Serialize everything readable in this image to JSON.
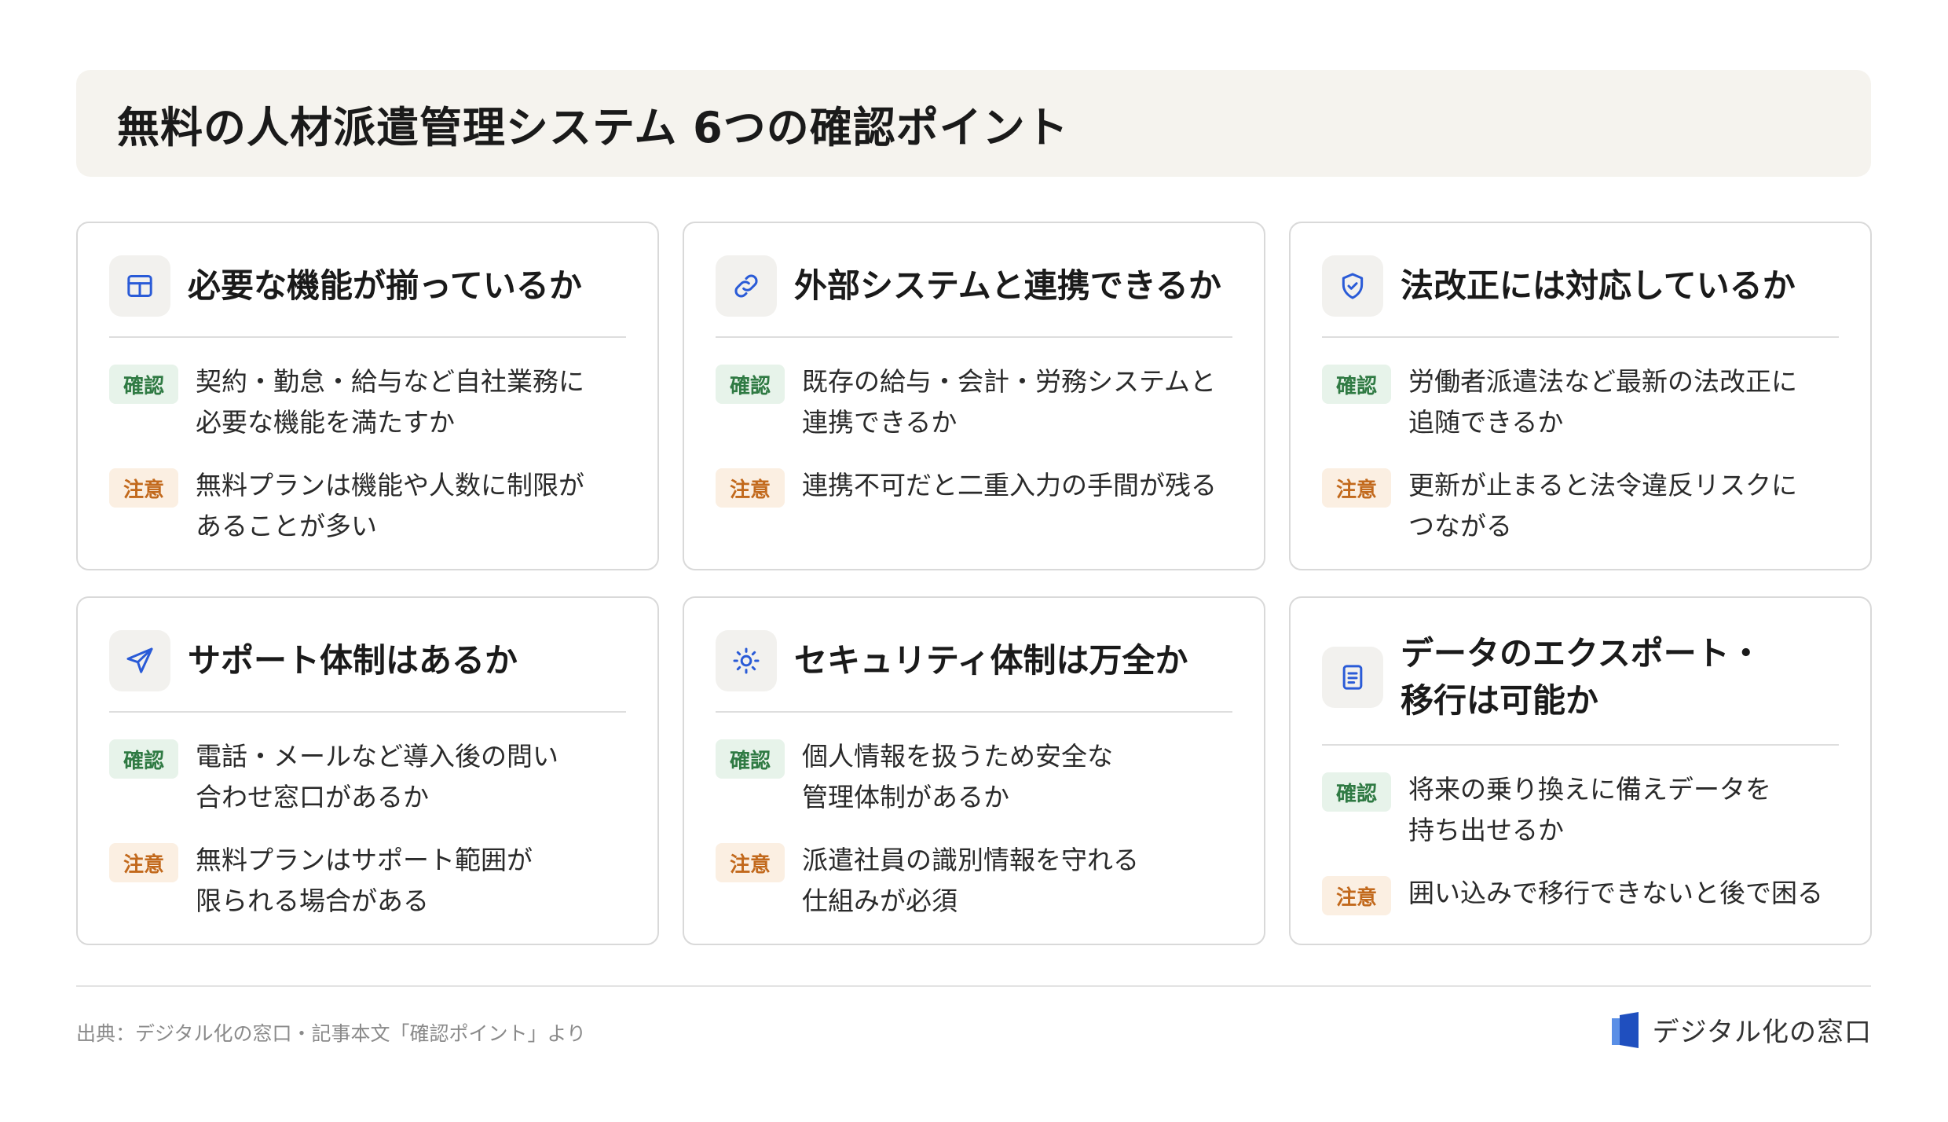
{
  "title": "無料の人材派遣管理システム 6つの確認ポイント",
  "badges": {
    "confirm": "確認",
    "caution": "注意"
  },
  "cards": [
    {
      "icon": "layout-grid-icon",
      "title": "必要な機能が揃っているか",
      "confirm": "契約・勤怠・給与など自社業務に\n必要な機能を満たすか",
      "caution": "無料プランは機能や人数に制限が\nあることが多い"
    },
    {
      "icon": "link-icon",
      "title": "外部システムと連携できるか",
      "confirm": "既存の給与・会計・労務システムと\n連携できるか",
      "caution": "連携不可だと二重入力の手間が残る"
    },
    {
      "icon": "shield-check-icon",
      "title": "法改正には対応しているか",
      "confirm": "労働者派遣法など最新の法改正に\n追随できるか",
      "caution": "更新が止まると法令違反リスクに\nつながる"
    },
    {
      "icon": "send-icon",
      "title": "サポート体制はあるか",
      "confirm": "電話・メールなど導入後の問い\n合わせ窓口があるか",
      "caution": "無料プランはサポート範囲が\n限られる場合がある"
    },
    {
      "icon": "sun-icon",
      "title": "セキュリティ体制は万全か",
      "confirm": "個人情報を扱うため安全な\n管理体制があるか",
      "caution": "派遣社員の識別情報を守れる\n仕組みが必須"
    },
    {
      "icon": "document-icon",
      "title": "データのエクスポート・\n移行は可能か",
      "confirm": "将来の乗り換えに備えデータを\n持ち出せるか",
      "caution": "囲い込みで移行できないと後で困る"
    }
  ],
  "footer": {
    "source": "出典：デジタル化の窓口・記事本文「確認ポイント」より",
    "brand": "デジタル化の窓口"
  },
  "colors": {
    "accent_icon": "#2a5bd7",
    "confirm_text": "#2f7a43",
    "confirm_bg": "#e7f3ea",
    "caution_text": "#c2691c",
    "caution_bg": "#fbefe2",
    "header_bg": "#f5f3ee"
  }
}
